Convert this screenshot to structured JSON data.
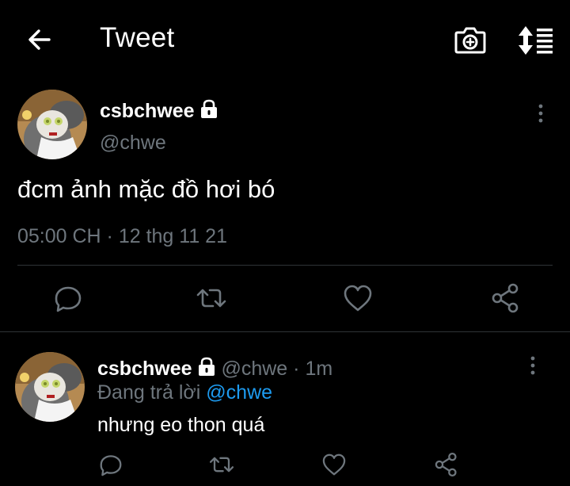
{
  "header": {
    "title": "Tweet",
    "icons": [
      "back-arrow-icon",
      "camera-plus-icon",
      "sort-icon"
    ]
  },
  "tweet": {
    "display_name": "csbchwee",
    "handle": "@chwe",
    "text": "đcm ảnh mặc đồ hơi bó",
    "timestamp": "05:00 CH · 12 thg 11 21",
    "actions": [
      "reply-icon",
      "retweet-icon",
      "like-icon",
      "share-icon"
    ]
  },
  "reply": {
    "display_name": "csbchwee",
    "handle": "@chwe",
    "separator": "·",
    "time": "1m",
    "replying_prefix": "Đang trả lời",
    "replying_to": "@chwe",
    "text": "nhưng eo thon quá"
  },
  "colors": {
    "background": "#000000",
    "text_primary": "#ffffff",
    "text_secondary": "#6e767d",
    "link": "#1d9bf0",
    "divider": "#2f3336"
  }
}
